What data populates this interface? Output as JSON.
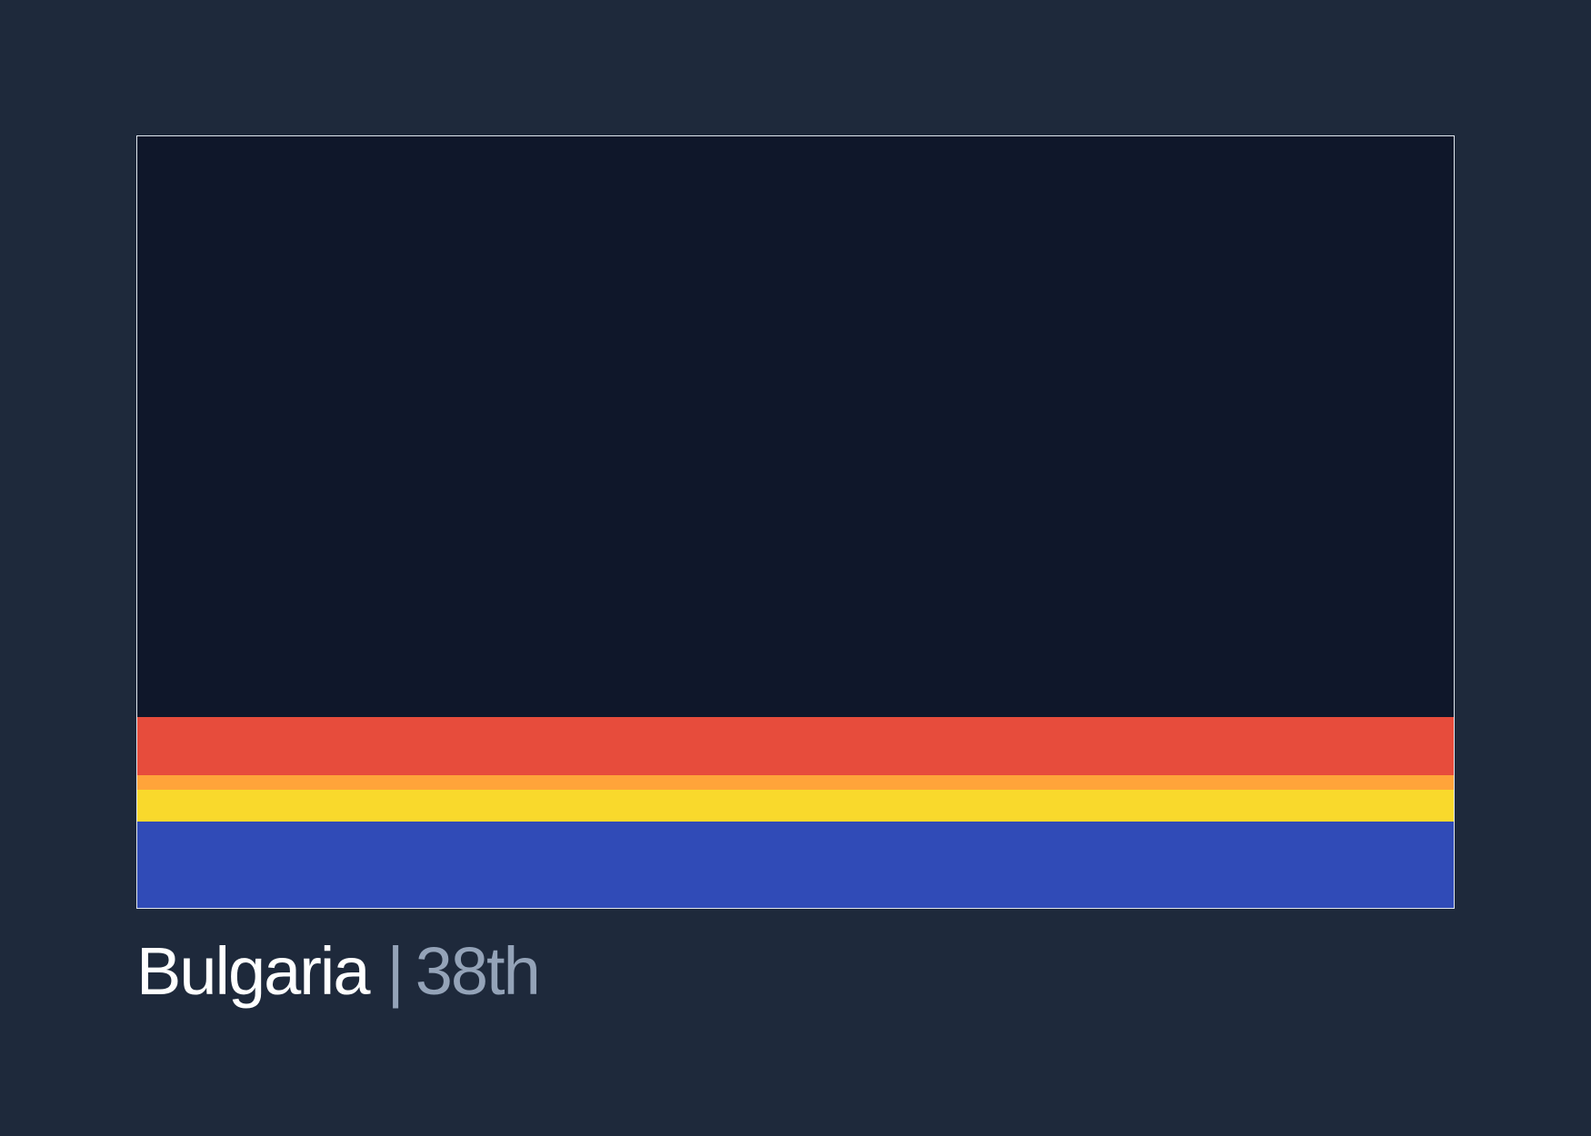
{
  "entry": {
    "country": "Bulgaria",
    "separator": "|",
    "rank": "38th"
  },
  "bands": [
    {
      "name": "red-band",
      "color": "#e74c3c",
      "share": 0.0759
    },
    {
      "name": "orange-band",
      "color": "#ffa43a",
      "share": 0.0189
    },
    {
      "name": "yellow-band",
      "color": "#f9d92c",
      "share": 0.0418
    },
    {
      "name": "blue-band",
      "color": "#304bb7",
      "share": 0.1118
    }
  ],
  "colors": {
    "background": "#1e293b",
    "panel": "#0f172a",
    "border": "#e2e8f0",
    "text_primary": "#ffffff",
    "text_muted": "#94a3b8"
  }
}
